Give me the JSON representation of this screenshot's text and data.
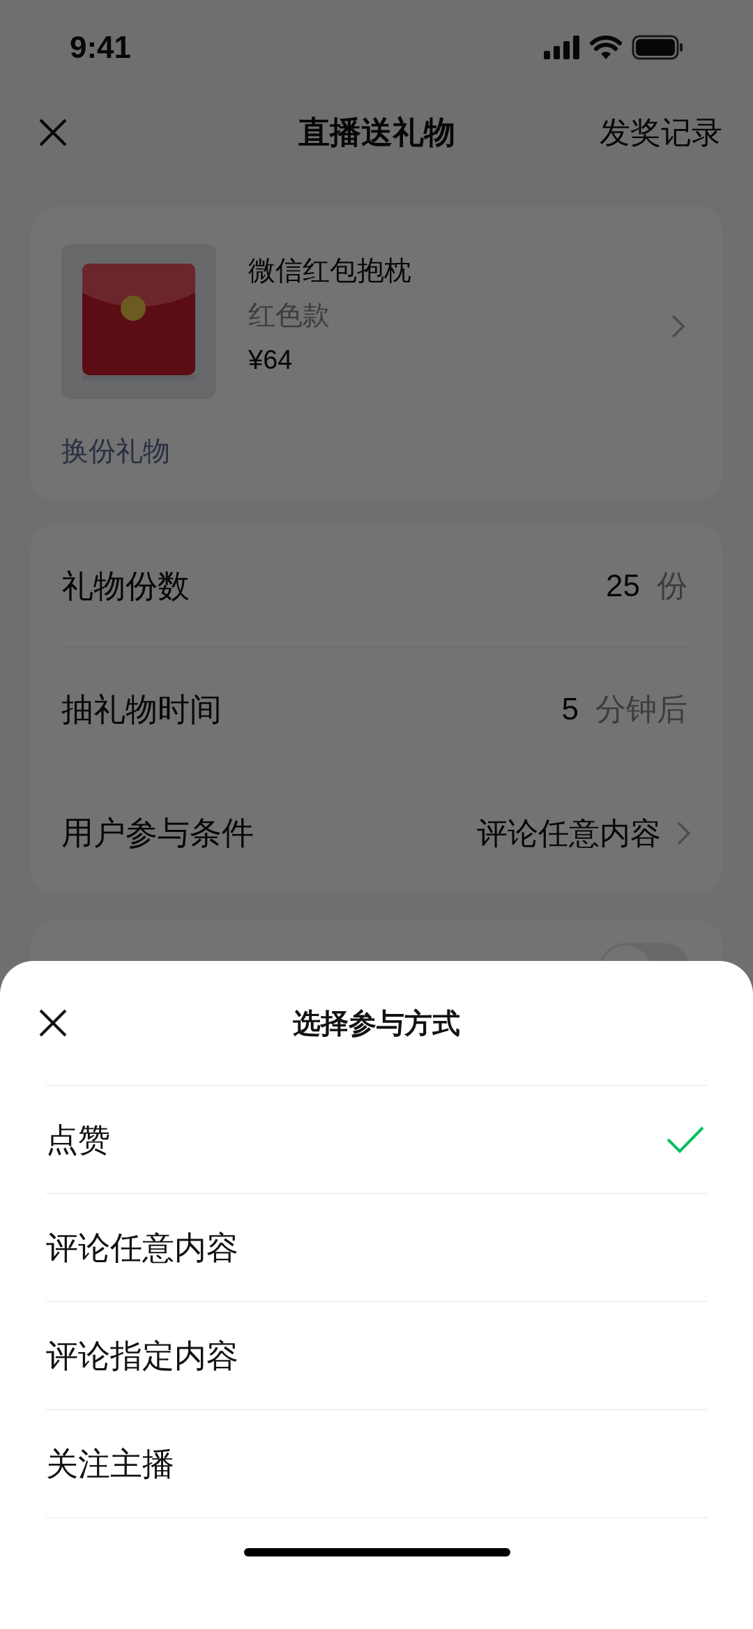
{
  "status_bar": {
    "time": "9:41"
  },
  "nav": {
    "title": "直播送礼物",
    "action": "发奖记录"
  },
  "gift": {
    "name": "微信红包抱枕",
    "variant": "红色款",
    "price": "¥64",
    "change_link": "换份礼物"
  },
  "settings": [
    {
      "label": "礼物份数",
      "value": "25",
      "unit": "份",
      "kind": "number"
    },
    {
      "label": "抽礼物时间",
      "value": "5",
      "unit": "分钟后",
      "kind": "number"
    },
    {
      "label": "用户参与条件",
      "value": "评论任意内容",
      "kind": "link"
    }
  ],
  "extra_card": {
    "toggle_on": false
  },
  "sheet": {
    "title": "选择参与方式",
    "options": [
      {
        "label": "点赞",
        "selected": true
      },
      {
        "label": "评论任意内容",
        "selected": false
      },
      {
        "label": "评论指定内容",
        "selected": false
      },
      {
        "label": "关注主播",
        "selected": false
      }
    ]
  }
}
